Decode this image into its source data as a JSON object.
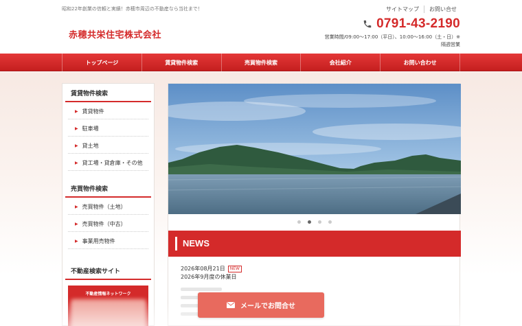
{
  "header": {
    "tagline": "昭和22年創業の信頼と実績！赤穂市周辺の不動産なら当社まで！",
    "company_name": "赤穂共栄住宅株式会社",
    "util_links": [
      "サイトマップ",
      "お問い合せ"
    ],
    "phone": "0791-43-2190",
    "hours_line1": "営業時間/09:00～17:00（平日）、10:00～16:00（土・日）※",
    "hours_line2": "隔週営業"
  },
  "nav": {
    "items": [
      "トップページ",
      "賃貸物件検索",
      "売買物件検索",
      "会社紹介",
      "お問い合わせ"
    ]
  },
  "sidebar": {
    "rental_head": "賃貸物件検索",
    "rental_items": [
      "賃貸物件",
      "駐車場",
      "貸土地",
      "貸工場・貸倉庫・その他"
    ],
    "sale_head": "売買物件検索",
    "sale_items": [
      "売買物件（土地）",
      "売買物件（中古）",
      "事業用売物件"
    ],
    "portal_head": "不動産検索サイト",
    "banner_caption": "不動産情報ネットワーク"
  },
  "slider": {
    "slide_count": 4,
    "active_index": 1
  },
  "news": {
    "title": "NEWS",
    "items": [
      {
        "date": "2026年08月21日",
        "badge": "NEW",
        "text": "2026年9月度の休業日"
      }
    ]
  },
  "mail_button": {
    "label": "メールでお問合せ"
  },
  "colors": {
    "accent": "#d42a2a",
    "mail_button": "#e86a5e"
  }
}
